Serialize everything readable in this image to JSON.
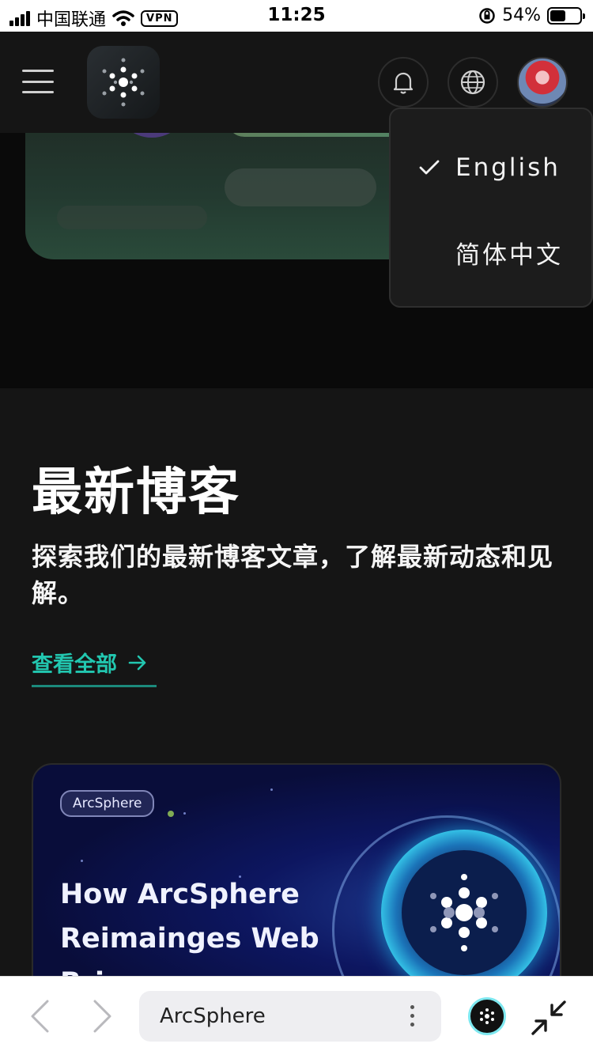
{
  "status_bar": {
    "carrier": "中国联通",
    "vpn": "VPN",
    "time": "11:25",
    "battery": "54%",
    "battery_level": 0.54
  },
  "header": {
    "menu_icon": "hamburger-icon",
    "logo_icon": "arcsphere-logo-icon",
    "bell_icon": "bell-icon",
    "globe_icon": "globe-icon",
    "avatar_icon": "user-avatar"
  },
  "language_menu": {
    "items": [
      {
        "label": "English",
        "selected": true
      },
      {
        "label": "简体中文",
        "selected": false
      }
    ]
  },
  "blog": {
    "title": "最新博客",
    "description": "探索我们的最新博客文章，了解最新动态和见解。",
    "view_all": "查看全部",
    "post": {
      "tag": "ArcSphere",
      "title": "How ArcSphere Reimainges Web Bri"
    }
  },
  "browser_bar": {
    "address": "ArcSphere",
    "back_icon": "chevron-left-icon",
    "forward_icon": "chevron-right-icon",
    "more_icon": "more-vertical-icon",
    "app_icon": "arcsphere-app-icon",
    "minimize_icon": "minimize-arrows-icon"
  },
  "colors": {
    "accent": "#22c7b0",
    "background": "#151515",
    "header": "#151515",
    "dropdown": "#1c1c1c"
  }
}
